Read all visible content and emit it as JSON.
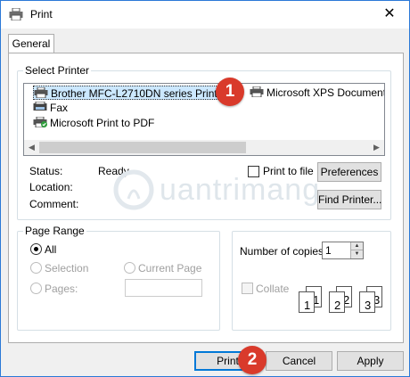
{
  "window": {
    "title": "Print",
    "close_glyph": "✕",
    "icon": "printer-icon"
  },
  "tabs": [
    {
      "label": "General",
      "active": true
    }
  ],
  "select_printer": {
    "label": "Select Printer",
    "printers": [
      {
        "name": "Brother MFC-L2710DN series Printer",
        "selected": true,
        "icon": "printer-icon"
      },
      {
        "name": "Microsoft XPS Document Writer",
        "selected": false,
        "icon": "printer-icon"
      },
      {
        "name": "Fax",
        "selected": false,
        "icon": "fax-icon"
      },
      {
        "name": "Microsoft Print to PDF",
        "selected": false,
        "icon": "default-printer-icon"
      }
    ]
  },
  "status": {
    "status_label": "Status:",
    "status_value": "Ready",
    "location_label": "Location:",
    "location_value": "",
    "comment_label": "Comment:",
    "comment_value": ""
  },
  "print_to_file": {
    "label": "Print to file",
    "checked": false
  },
  "buttons": {
    "preferences": "Preferences",
    "find_printer": "Find Printer...",
    "print": "Print",
    "cancel": "Cancel",
    "apply": "Apply"
  },
  "page_range": {
    "label": "Page Range",
    "all": "All",
    "selection": "Selection",
    "current_page": "Current Page",
    "pages": "Pages:",
    "selected_option": "All"
  },
  "copies": {
    "label": "Number of copies:",
    "value": "1",
    "collate_label": "Collate",
    "collate_checked": false,
    "collate_pages": [
      "1",
      "1",
      "2",
      "2",
      "3",
      "3"
    ]
  },
  "annotations": {
    "badge_1": "1",
    "badge_2": "2"
  },
  "watermark": {
    "text": "uantrimang",
    "letter": "Q"
  },
  "colors": {
    "badge": "#d93a2b",
    "selection": "#cce8ff",
    "accent": "#0078d7"
  }
}
